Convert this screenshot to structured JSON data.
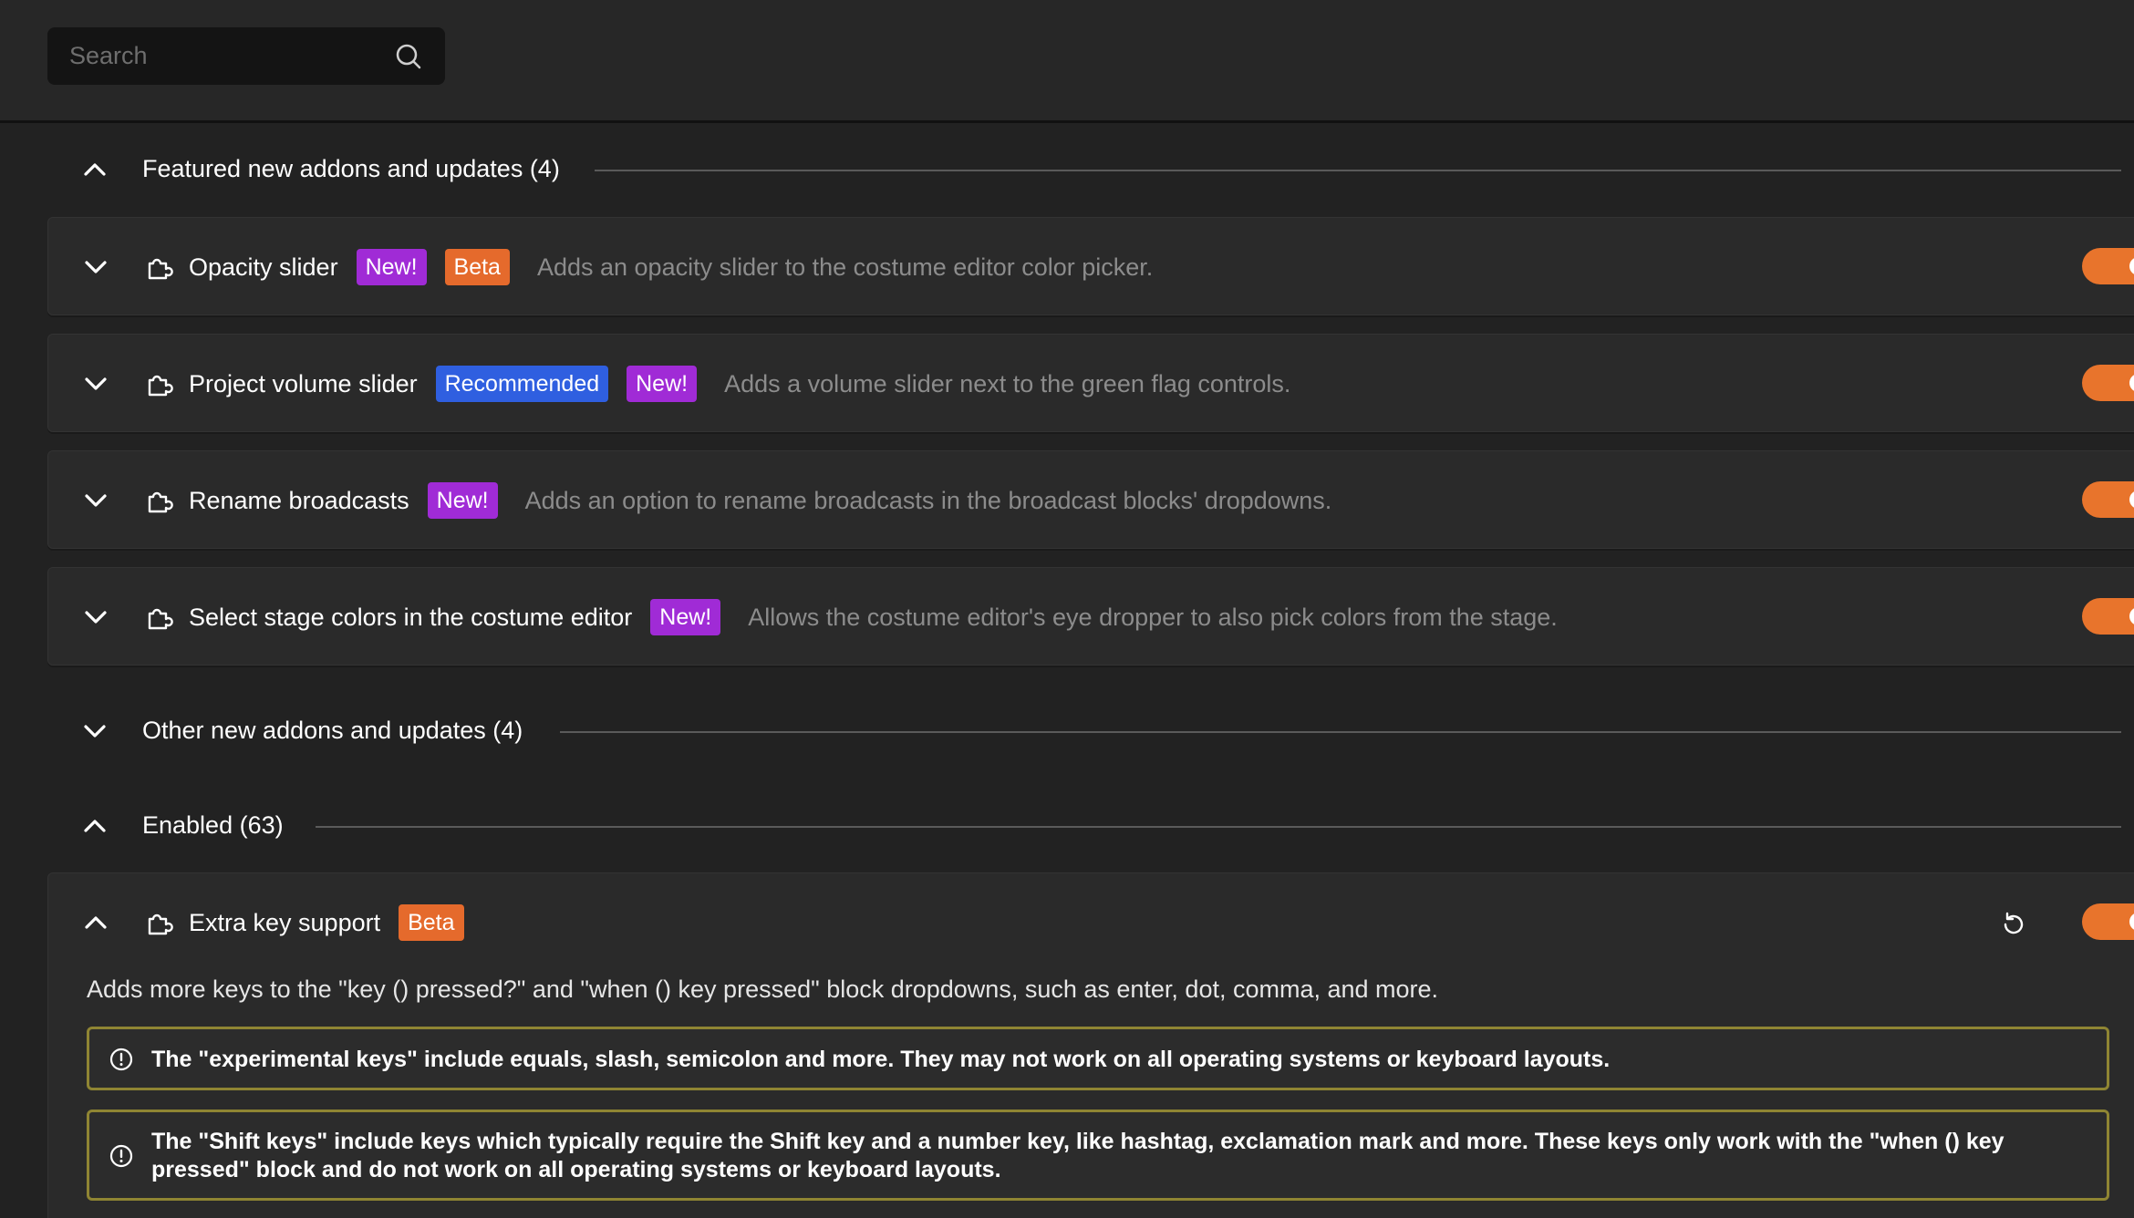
{
  "search": {
    "placeholder": "Search"
  },
  "sections": {
    "featured": {
      "title": "Featured new addons and updates (4)",
      "expanded": true
    },
    "other": {
      "title": "Other new addons and updates (4)",
      "expanded": false
    },
    "enabled": {
      "title": "Enabled (63)",
      "expanded": true
    }
  },
  "addons": [
    {
      "name": "Opacity slider",
      "badges": [
        "New!",
        "Beta"
      ],
      "description": "Adds an opacity slider to the costume editor color picker.",
      "enabled": true
    },
    {
      "name": "Project volume slider",
      "badges": [
        "Recommended",
        "New!"
      ],
      "description": "Adds a volume slider next to the green flag controls.",
      "enabled": true
    },
    {
      "name": "Rename broadcasts",
      "badges": [
        "New!"
      ],
      "description": "Adds an option to rename broadcasts in the broadcast blocks' dropdowns.",
      "enabled": true
    },
    {
      "name": "Select stage colors in the costume editor",
      "badges": [
        "New!"
      ],
      "description": "Allows the costume editor's eye dropper to also pick colors from the stage.",
      "enabled": true
    }
  ],
  "expanded_addon": {
    "name": "Extra key support",
    "badge": "Beta",
    "description": "Adds more keys to the \"key () pressed?\" and \"when () key pressed\" block dropdowns, such as enter, dot, comma, and more.",
    "notices": [
      "The \"experimental keys\" include equals, slash, semicolon and more. They may not work on all operating systems or keyboard layouts.",
      "The \"Shift keys\" include keys which typically require the Shift key and a number key, like hashtag, exclamation mark and more. These keys only work with the \"when () key pressed\" block and do not work on all operating systems or keyboard layouts."
    ],
    "enabled": true
  },
  "colors": {
    "background": "#222222",
    "toggle_on": "#e8742c",
    "badge_new": "#a02bd6",
    "badge_beta": "#e56a2c",
    "badge_recommended": "#2f5fe0",
    "notice_border": "#8f8533"
  },
  "icons": {
    "search": "search-icon",
    "addon": "puzzle-icon",
    "collapse": "chevron-up-icon",
    "expand": "chevron-down-icon",
    "reset": "reset-icon",
    "info": "info-icon"
  }
}
